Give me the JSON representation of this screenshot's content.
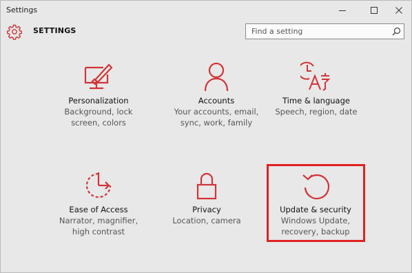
{
  "window": {
    "title": "Settings"
  },
  "header": {
    "title": "SETTINGS",
    "search_placeholder": "Find a setting"
  },
  "accent_color": "#d13438",
  "highlight_color": "#e02020",
  "tiles": [
    {
      "icon": "personalization-icon",
      "label": "Personalization",
      "desc_line1": "Background, lock",
      "desc_line2": "screen, colors"
    },
    {
      "icon": "accounts-icon",
      "label": "Accounts",
      "desc_line1": "Your accounts, email,",
      "desc_line2": "sync, work, family"
    },
    {
      "icon": "time-language-icon",
      "label": "Time & language",
      "desc_line1": "Speech, region, date",
      "desc_line2": ""
    },
    {
      "icon": "ease-of-access-icon",
      "label": "Ease of Access",
      "desc_line1": "Narrator, magnifier,",
      "desc_line2": "high contrast"
    },
    {
      "icon": "privacy-icon",
      "label": "Privacy",
      "desc_line1": "Location, camera",
      "desc_line2": ""
    },
    {
      "icon": "update-security-icon",
      "label": "Update & security",
      "desc_line1": "Windows Update,",
      "desc_line2": "recovery, backup"
    }
  ]
}
